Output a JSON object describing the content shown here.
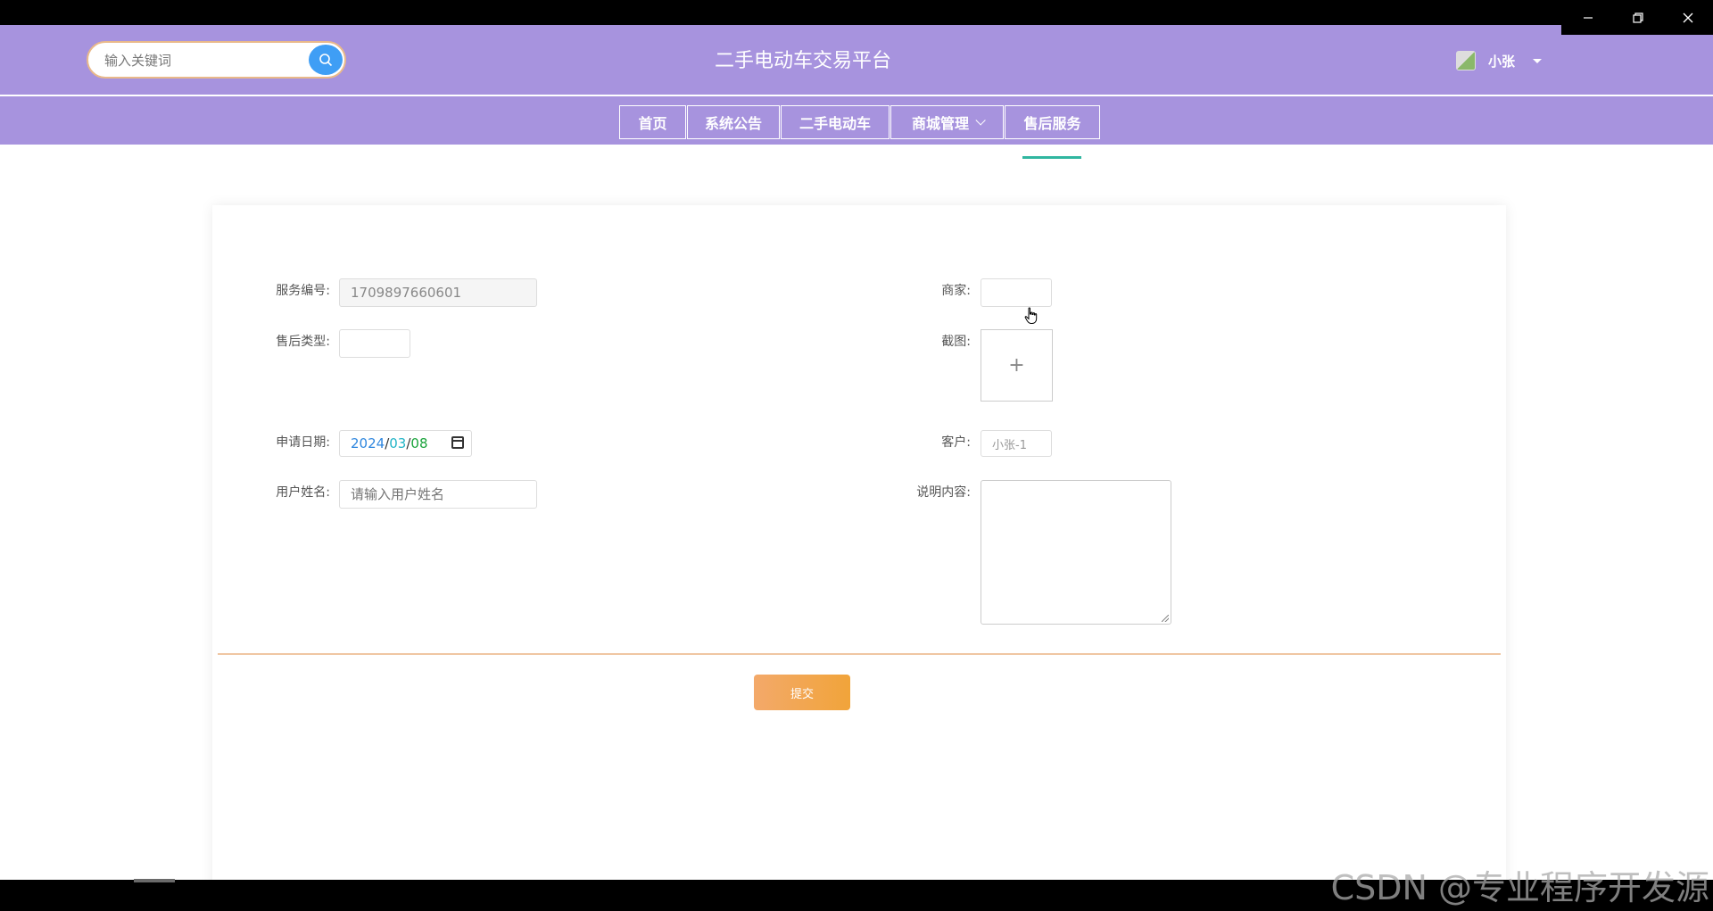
{
  "header": {
    "search_placeholder": "输入关键词",
    "site_title": "二手电动车交易平台",
    "username": "小张"
  },
  "nav": {
    "items": [
      "首页",
      "系统公告",
      "二手电动车",
      "商城管理",
      "售后服务"
    ]
  },
  "form": {
    "service_no_label": "服务编号:",
    "service_no_value": "1709897660601",
    "aftersale_type_label": "售后类型:",
    "apply_date_label": "申请日期:",
    "apply_date_year": "2024",
    "apply_date_month": "03",
    "apply_date_day": "08",
    "user_name_label": "用户姓名:",
    "user_name_placeholder": "请输入用户姓名",
    "merchant_label": "商家:",
    "screenshot_label": "截图:",
    "screenshot_plus": "+",
    "customer_label": "客户:",
    "customer_value": "小张-1",
    "description_label": "说明内容:",
    "submit_label": "提交"
  },
  "watermark": "CSDN @专业程序开发源",
  "colors": {
    "header_bg": "#a793de",
    "search_btn": "#3f9ef5",
    "active_underline": "#30b6a0",
    "submit_start": "#f3a96a",
    "submit_end": "#f1a43a"
  },
  "icons": {
    "search": "search-icon",
    "minimize": "minimize-icon",
    "restore": "restore-icon",
    "close": "close-icon",
    "calendar": "calendar-icon",
    "cursor": "hand-cursor-icon"
  }
}
